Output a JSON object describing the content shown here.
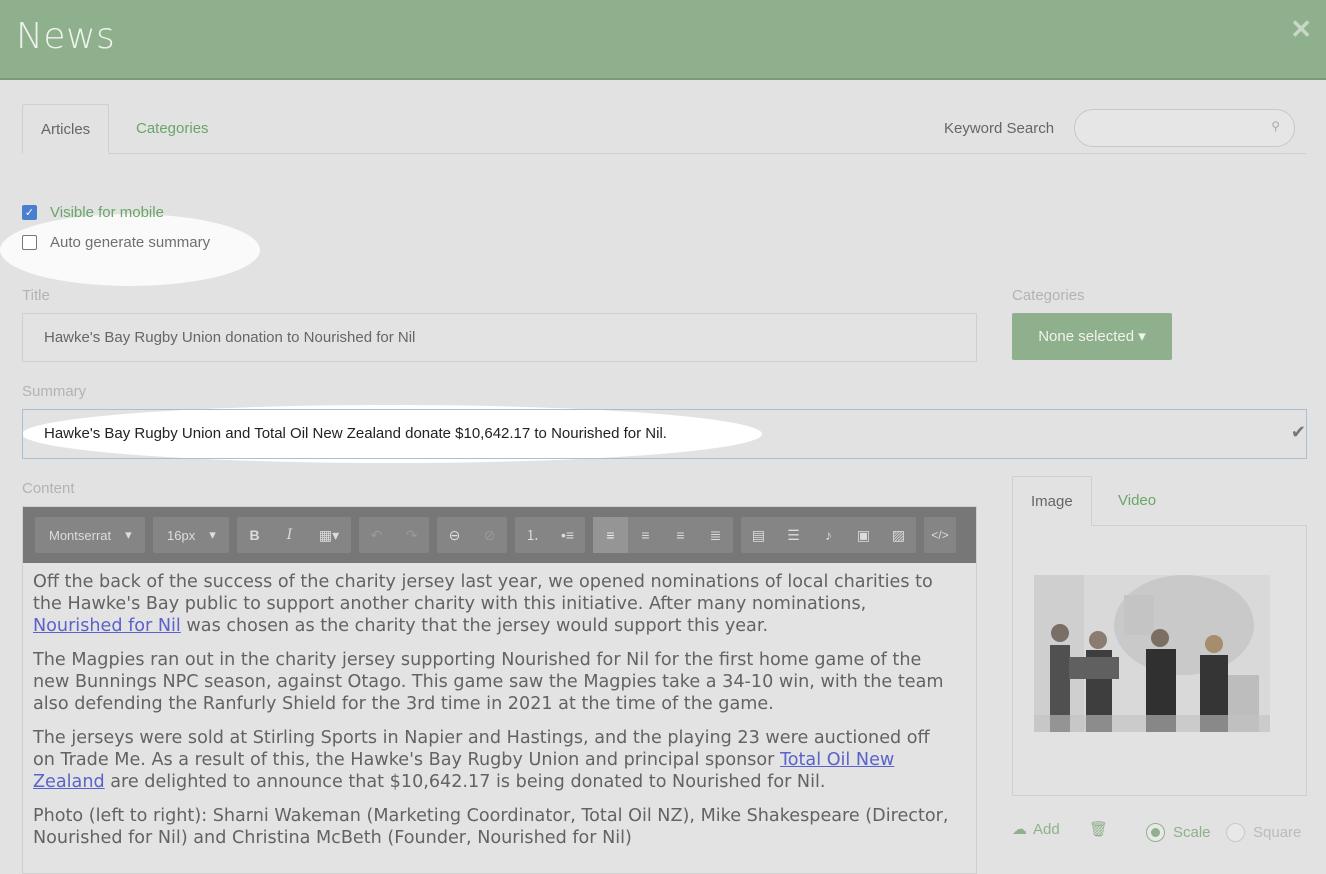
{
  "header": {
    "title": "News",
    "close_label": "✕"
  },
  "tabs": {
    "articles": "Articles",
    "categories": "Categories"
  },
  "keyword_search": {
    "label": "Keyword Search",
    "value": "",
    "placeholder": ""
  },
  "options": {
    "visible_mobile": {
      "label": "Visible for mobile",
      "checked": true
    },
    "auto_summary": {
      "label": "Auto generate summary",
      "checked": false
    }
  },
  "title_field": {
    "label": "Title",
    "value": "Hawke's Bay Rugby Union donation to Nourished for Nil"
  },
  "categories_field": {
    "label": "Categories",
    "button": "None selected ▾"
  },
  "summary_field": {
    "label": "Summary",
    "value": "Hawke's Bay Rugby Union and Total Oil New Zealand donate $10,642.17 to Nourished for Nil."
  },
  "content_field": {
    "label": "Content"
  },
  "toolbar": {
    "font": "Montserrat",
    "size": "16px",
    "bold": "B",
    "italic": "I"
  },
  "content": {
    "p1_before": "Off the back of the success of the charity jersey last year, we opened nominations of local charities to the Hawke's Bay public to support another charity with this initiative. After many nominations, ",
    "p1_link": "Nourished for Nil",
    "p1_after": " was chosen as the charity that the jersey would support this year.",
    "p2": "The Magpies ran out in the charity jersey supporting Nourished for Nil for the first home game of the new Bunnings NPC season, against Otago. This game saw the Magpies take a 34-10 win, with the team also defending the Ranfurly Shield for the 3rd time in 2021 at the time of the game.",
    "p3_before": "The jerseys were sold at Stirling Sports in Napier and Hastings, and the playing 23 were auctioned off on Trade Me. As a result of this, the Hawke's Bay Rugby Union and principal sponsor ",
    "p3_link": "Total Oil New Zealand",
    "p3_after": " are delighted to announce that $10,642.17 is being donated to Nourished for Nil.",
    "p4": "Photo (left to right): Sharni Wakeman (Marketing Coordinator, Total Oil NZ), Mike Shakespeare (Director, Nourished for Nil) and Christina McBeth (Founder, Nourished for Nil)"
  },
  "media": {
    "tab_image": "Image",
    "tab_video": "Video",
    "add_label": "Add",
    "scale_label": "Scale",
    "square_label": "Square",
    "selected_mode": "Scale"
  },
  "colors": {
    "brand_green": "#8fb08c",
    "link_green": "#6aa56a",
    "link_blue": "#5b62c9"
  }
}
